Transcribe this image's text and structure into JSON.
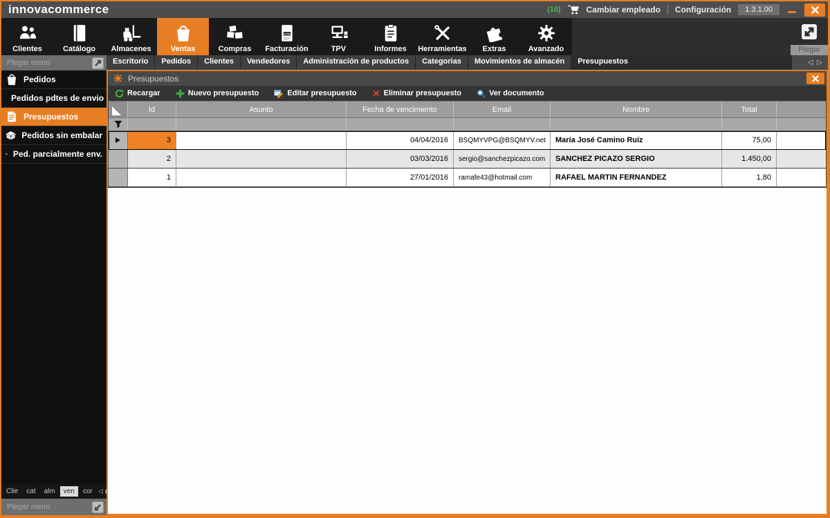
{
  "app": {
    "logo": "innovacommerce",
    "cart_count": "(10)",
    "change_employee": "Cambiar empleado",
    "settings": "Configuración",
    "version": "1.3.1.00"
  },
  "ribbon": {
    "items": [
      "Clientes",
      "Catálogo",
      "Almacenes",
      "Ventas",
      "Compras",
      "Facturación",
      "TPV",
      "Informes",
      "Herramientas",
      "Extras",
      "Avanzado"
    ],
    "active_item": "Ventas",
    "collapse_label": "Plegar"
  },
  "tabs": {
    "items": [
      "Escritorio",
      "Pedidos",
      "Clientes",
      "Vendedores",
      "Administración de productos",
      "Categorias",
      "Movimientos de almacén",
      "Presupuestos"
    ],
    "active_tab": "Presupuestos"
  },
  "sidebar": {
    "header_label": "Plegar menú",
    "footer_label": "Plegar menú",
    "items": [
      "Pedidos",
      "Pedidos pdtes de envio",
      "Presupuestos",
      "Pedidos sin embalar",
      "Ped. parcialmente env."
    ],
    "active_item": "Presupuestos",
    "mini_tabs": [
      "Clie",
      "cat",
      "alm",
      "ven",
      "cor"
    ],
    "active_mini_tab": "ven"
  },
  "window": {
    "title": "Presupuestos",
    "toolbar": {
      "reload": "Recargar",
      "new": "Nuevo presupuesto",
      "edit": "Editar presupuesto",
      "delete": "Eliminar presupuesto",
      "view": "Ver documento"
    },
    "table": {
      "columns": {
        "id": "Id",
        "subject": "Asunto",
        "due_date": "Fecha de vencimiento",
        "email": "Email",
        "name": "Nombre",
        "total": "Total"
      },
      "rows": [
        {
          "id": "3",
          "subject": "",
          "due_date": "04/04/2016",
          "email": "BSQMYVPG@BSQMYV.net",
          "name": "María José Camino Ruíz",
          "total": "75,00",
          "selected": true
        },
        {
          "id": "2",
          "subject": "",
          "due_date": "03/03/2016",
          "email": "sergio@sanchezpicazo.com",
          "name": "SANCHEZ PICAZO SERGIO",
          "total": "1.450,00",
          "selected": false
        },
        {
          "id": "1",
          "subject": "",
          "due_date": "27/01/2016",
          "email": "ramafe43@hotmail.com",
          "name": "RAFAEL MARTIN FERNANDEZ",
          "total": "1,80",
          "selected": false
        }
      ]
    }
  },
  "colors": {
    "accent": "#e87e23",
    "selected_cell": "#ef8222",
    "cart_count_green": "#4db84f",
    "delete_red": "#c9463d",
    "toolbar_green": "#45b049"
  }
}
